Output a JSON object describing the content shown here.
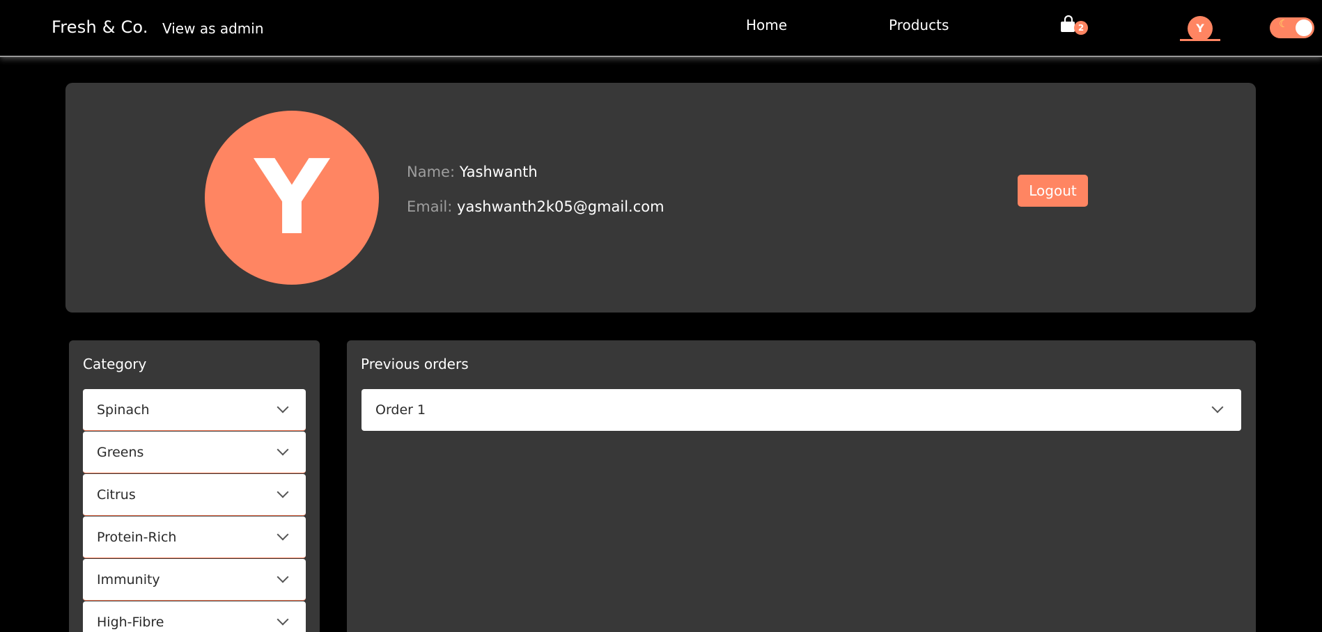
{
  "nav": {
    "brand": "Fresh & Co.",
    "admin_link": "View as admin",
    "links": [
      "Home",
      "Products"
    ],
    "cart_count": "2",
    "avatar_initial": "Y",
    "cart_icon": "shopping-bag-icon",
    "theme_toggle_icon": "moon-icon"
  },
  "profile": {
    "avatar_initial": "Y",
    "name_label": "Name:",
    "name_value": "Yashwanth",
    "email_label": "Email:",
    "email_value": "yashwanth2k05@gmail.com",
    "logout_label": "Logout"
  },
  "categories": {
    "title": "Category",
    "items": [
      "Spinach",
      "Greens",
      "Citrus",
      "Protein-Rich",
      "Immunity",
      "High-Fibre"
    ]
  },
  "orders": {
    "title": "Previous orders",
    "items": [
      "Order 1"
    ]
  },
  "colors": {
    "accent": "#ff8562",
    "panel": "#383838",
    "background": "#000000"
  }
}
